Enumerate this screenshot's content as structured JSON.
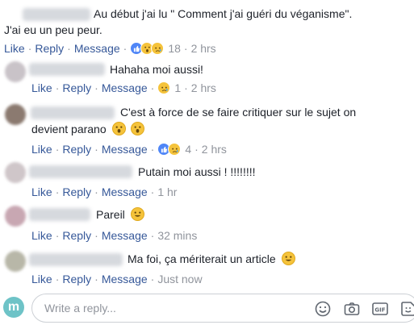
{
  "action_labels": {
    "like": "Like",
    "reply": "Reply",
    "message": "Message",
    "sep": "·"
  },
  "comments": [
    {
      "text": "Au début j'ai lu \" Comment j'ai guéri du véganisme\".",
      "text2": "J'ai eu un peu peur.",
      "reactions": [
        "like",
        "wow",
        "sad"
      ],
      "reaction_count": "18",
      "time": "2 hrs"
    },
    {
      "text": "Hahaha moi aussi!",
      "reactions": [
        "sad"
      ],
      "reaction_count": "1",
      "time": "2 hrs"
    },
    {
      "text": "C'est à force de se faire critiquer sur le sujet on",
      "text2": "devient parano",
      "emojis": [
        "wow",
        "wow"
      ],
      "reactions": [
        "like",
        "sad"
      ],
      "reaction_count": "4",
      "time": "2 hrs"
    },
    {
      "text": "Putain moi aussi ! !!!!!!!!",
      "time": "1 hr"
    },
    {
      "text": "Pareil",
      "emojis": [
        "smile"
      ],
      "time": "32 mins"
    },
    {
      "text": "Ma foi, ça mériterait un article",
      "emojis": [
        "smile"
      ],
      "time": "Just now"
    }
  ],
  "reply_box": {
    "avatar_letter": "m",
    "placeholder": "Write a reply..."
  },
  "icons": [
    "like-reaction-icon",
    "wow-reaction-icon",
    "sad-reaction-icon",
    "smiley-icon",
    "camera-icon",
    "gif-icon",
    "sticker-icon"
  ],
  "colors": {
    "link": "#365899",
    "meta": "#90949c",
    "text": "#1d2129",
    "like_blue": "#4f86f7",
    "emoji_yellow": "#f5c33b",
    "avatar_teal": "#6ec3c7"
  }
}
